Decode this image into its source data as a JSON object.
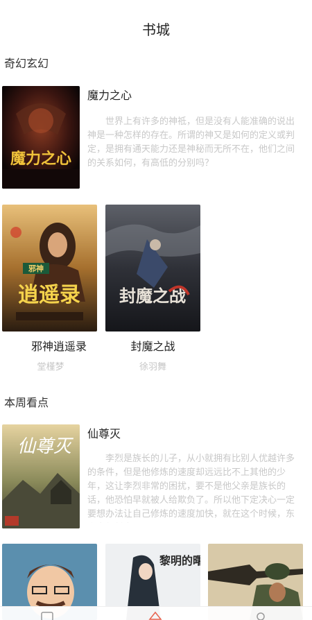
{
  "header": {
    "title": "书城"
  },
  "sections": [
    {
      "title": "奇幻玄幻",
      "featured": {
        "name": "魔力之心",
        "desc": "世界上有许多的神祗，但是没有人能准确的说出神是一种怎样的存在。所谓的神又是如何的定义或判定，是拥有通天能力还是神秘而无所不在，他们之间的关系如何，有高低的分别吗？",
        "cover_text": "魔力之心"
      },
      "grid": [
        {
          "name": "邪神逍遥录",
          "author": "堂槿梦",
          "cover_text": "逍遥录",
          "cover_badge": "邪神"
        },
        {
          "name": "封魔之战",
          "author": "徐羽舞",
          "cover_text": "封魔之战"
        }
      ]
    },
    {
      "title": "本周看点",
      "featured": {
        "name": "仙尊灭",
        "desc": "李烈是族长的儿子，从小就拥有比别人优越许多的条件，但是他修炼的速度却远远比不上其他的少年，这让李烈非常的困扰，要不是他父亲是族长的话，他恐怕早就被人给欺负了。所以他下定决心一定要想办法让自己修炼的速度加快，就在这个时候，东方突然射出了一...",
        "cover_text": "仙尊灭"
      },
      "grid_covers": [
        {
          "label": "cartoon"
        },
        {
          "label": "黎明的曙"
        },
        {
          "label": "soldier"
        }
      ]
    }
  ],
  "colors": {
    "desc": "#c8c8c8",
    "accent": "#e8604c"
  }
}
